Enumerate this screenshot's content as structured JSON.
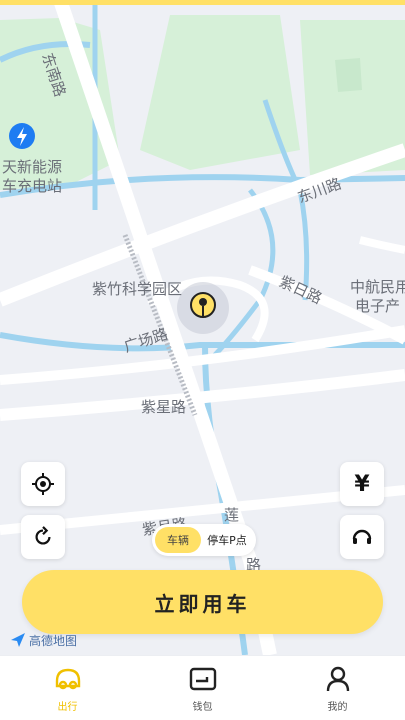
{
  "map": {
    "labels": {
      "road_nw": "东南路",
      "charging_station": "天新能源\n车充电站",
      "dongchuan_road": "东川路",
      "park": "紫竹科学园区",
      "guangchang_road": "广场路",
      "ziri_road": "紫日路",
      "company": "中航民用\n电子产",
      "zixing_road": "紫星路",
      "bottom_road_a": "紫月路",
      "bottom_road_b": "莲",
      "bottom_road_c": "路"
    },
    "logo_text": "高德地图"
  },
  "controls": {
    "fare_symbol": "¥"
  },
  "mode_toggle": {
    "vehicle": "车辆",
    "parking": "停车P点"
  },
  "cta": {
    "label": "立即用车"
  },
  "tabbar": {
    "items": [
      {
        "label": "出行",
        "icon": "car-face-icon",
        "active": true
      },
      {
        "label": "钱包",
        "icon": "wallet-icon",
        "active": false
      },
      {
        "label": "我的",
        "icon": "user-icon",
        "active": false
      }
    ]
  },
  "colors": {
    "accent": "#ffe066",
    "active_tab": "#f0c000",
    "water": "#9fd3ef",
    "green": "#d6f0d8",
    "road": "#ffffff"
  }
}
